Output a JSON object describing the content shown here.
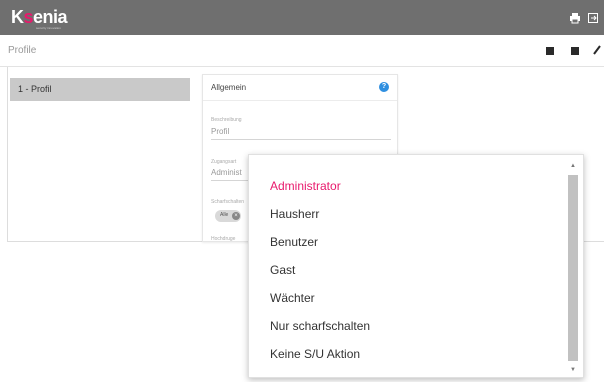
{
  "app": {
    "logo_prefix": "K",
    "logo_accent": "s",
    "logo_rest": "enia",
    "logo_subtext": "security innovation"
  },
  "topbar": {
    "icons": [
      "printer-icon",
      "logout-icon"
    ]
  },
  "subbar": {
    "title": "Profile"
  },
  "profiles": {
    "items": [
      {
        "label": "1 - Profil"
      }
    ]
  },
  "card": {
    "title": "Allgemein",
    "help_symbol": "?",
    "fields": [
      {
        "label": "Beschreibung",
        "value": "Profil"
      },
      {
        "label": "Zugangsart",
        "value": "Administ"
      },
      {
        "label": "Scharfschalten"
      },
      {
        "label": "Hochdruge"
      }
    ],
    "pill": {
      "label": "Alle",
      "close_symbol": "×"
    }
  },
  "dropdown": {
    "options": [
      {
        "label": "Administrator",
        "selected": true
      },
      {
        "label": "Hausherr",
        "selected": false
      },
      {
        "label": "Benutzer",
        "selected": false
      },
      {
        "label": "Gast",
        "selected": false
      },
      {
        "label": "Wächter",
        "selected": false
      },
      {
        "label": "Nur scharfschalten",
        "selected": false
      },
      {
        "label": "Keine S/U Aktion",
        "selected": false
      }
    ],
    "scroll_up": "▲",
    "scroll_down": "▼"
  },
  "colors": {
    "accent": "#e8196c",
    "topbar": "#6f6f6f",
    "help": "#2f8fe0"
  }
}
